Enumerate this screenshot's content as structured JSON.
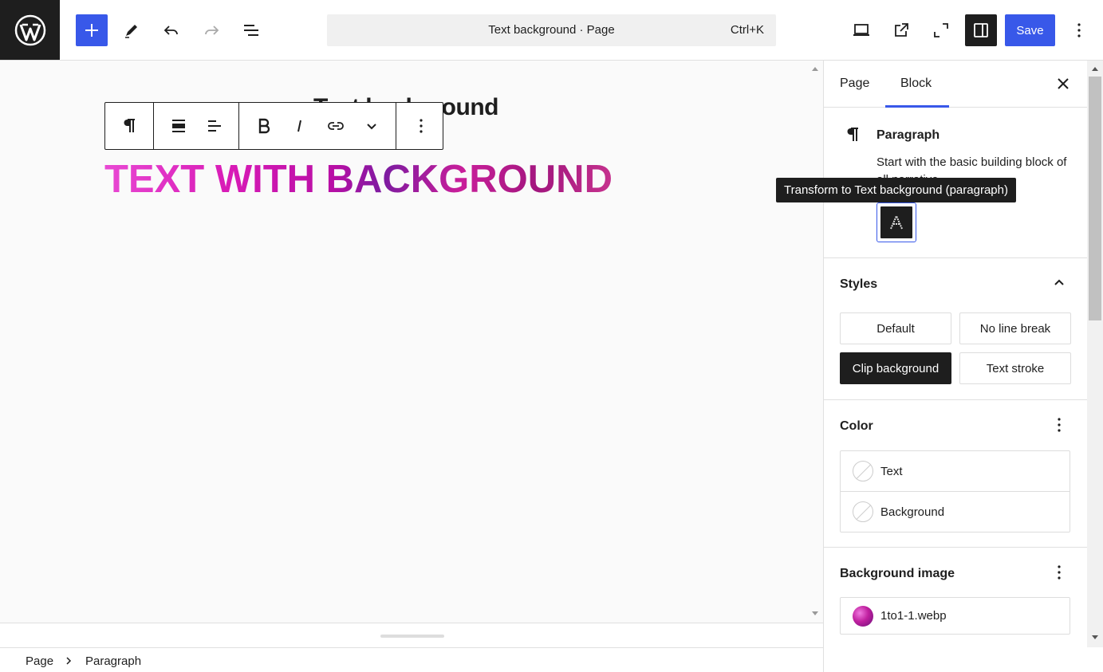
{
  "header": {
    "document_title": "Text background · Page",
    "shortcut": "Ctrl+K",
    "save_label": "Save"
  },
  "canvas": {
    "page_title": "Text background",
    "block_text": "TEXT WITH BACKGROUND"
  },
  "breadcrumb": {
    "items": [
      "Page",
      "Paragraph"
    ]
  },
  "sidebar": {
    "tabs": [
      "Page",
      "Block"
    ],
    "active_tab": "Block",
    "block_card": {
      "title": "Paragraph",
      "description": "Start with the basic building block of all narrative."
    },
    "tooltip": "Transform to Text background (paragraph)",
    "styles": {
      "title": "Styles",
      "options": [
        "Default",
        "No line break",
        "Clip background",
        "Text stroke"
      ],
      "active": "Clip background"
    },
    "color": {
      "title": "Color",
      "items": [
        "Text",
        "Background"
      ]
    },
    "background_image": {
      "title": "Background image",
      "file": "1to1-1.webp"
    }
  },
  "colors": {
    "accent": "#3858e9",
    "dark": "#1e1e1e",
    "gradient_pink": "#e94ad4",
    "gradient_purple": "#7d1ba0"
  }
}
